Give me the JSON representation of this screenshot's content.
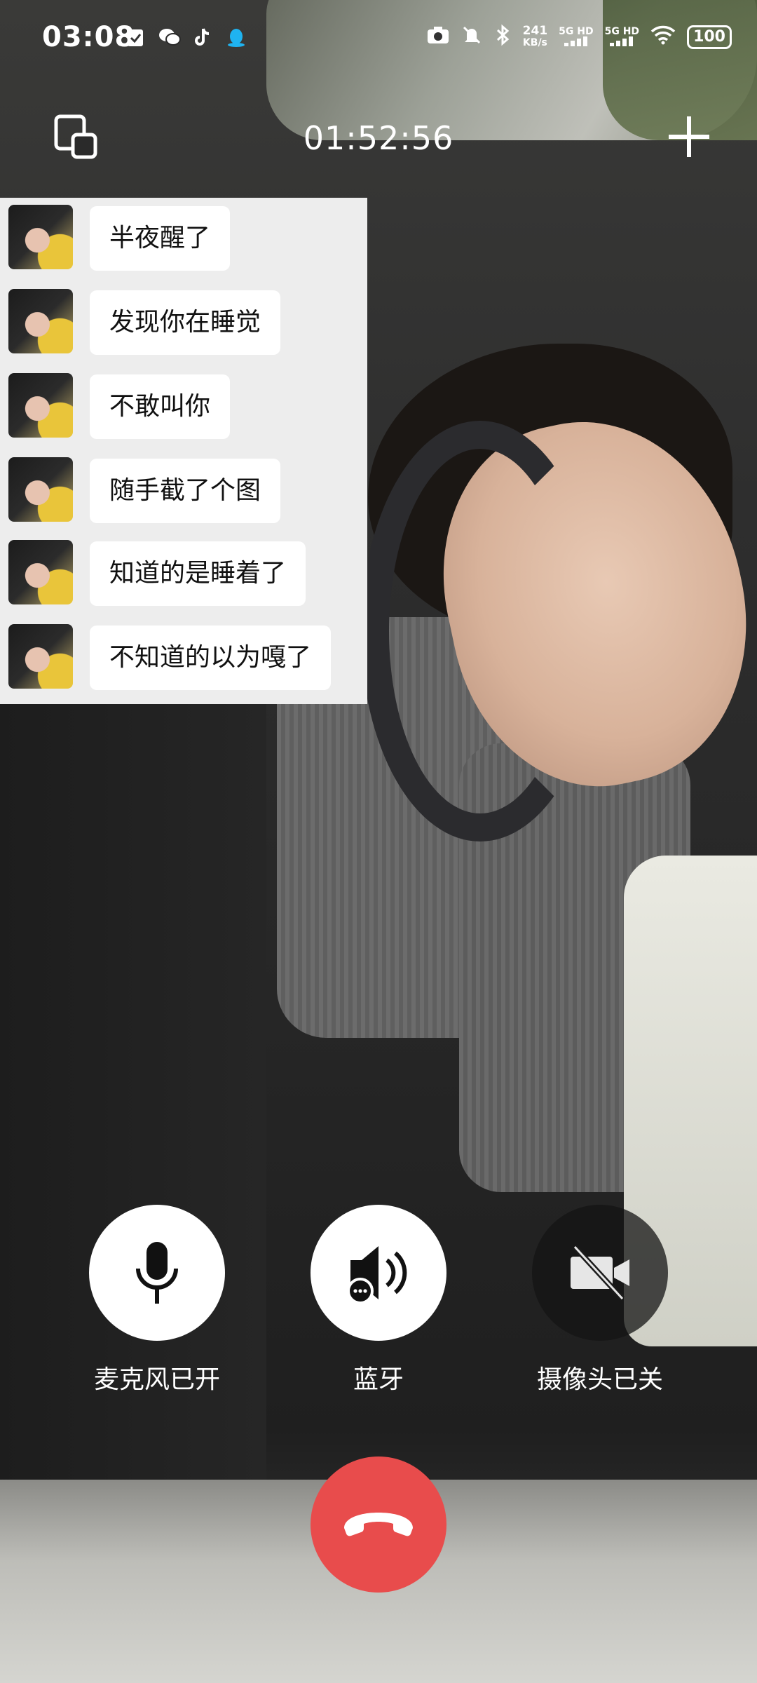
{
  "status_bar": {
    "time": "03:08",
    "net_speed_value": "241",
    "net_speed_unit": "KB/s",
    "sim1": "5G HD",
    "sim2": "5G HD",
    "battery": "100"
  },
  "call": {
    "duration": "01:52:56"
  },
  "chat": {
    "messages": [
      {
        "text": "半夜醒了"
      },
      {
        "text": "发现你在睡觉"
      },
      {
        "text": "不敢叫你"
      },
      {
        "text": "随手截了个图"
      },
      {
        "text": "知道的是睡着了"
      },
      {
        "text": "不知道的以为嘎了"
      }
    ]
  },
  "controls": {
    "mic_label": "麦克风已开",
    "speaker_label": "蓝牙",
    "camera_label": "摄像头已关"
  },
  "colors": {
    "hangup": "#e84c4c",
    "chat_bg": "#ededed"
  },
  "icons": [
    "minimize-window-icon",
    "add-icon",
    "microphone-icon",
    "bluetooth-speaker-icon",
    "camera-off-icon",
    "hang-up-icon"
  ]
}
